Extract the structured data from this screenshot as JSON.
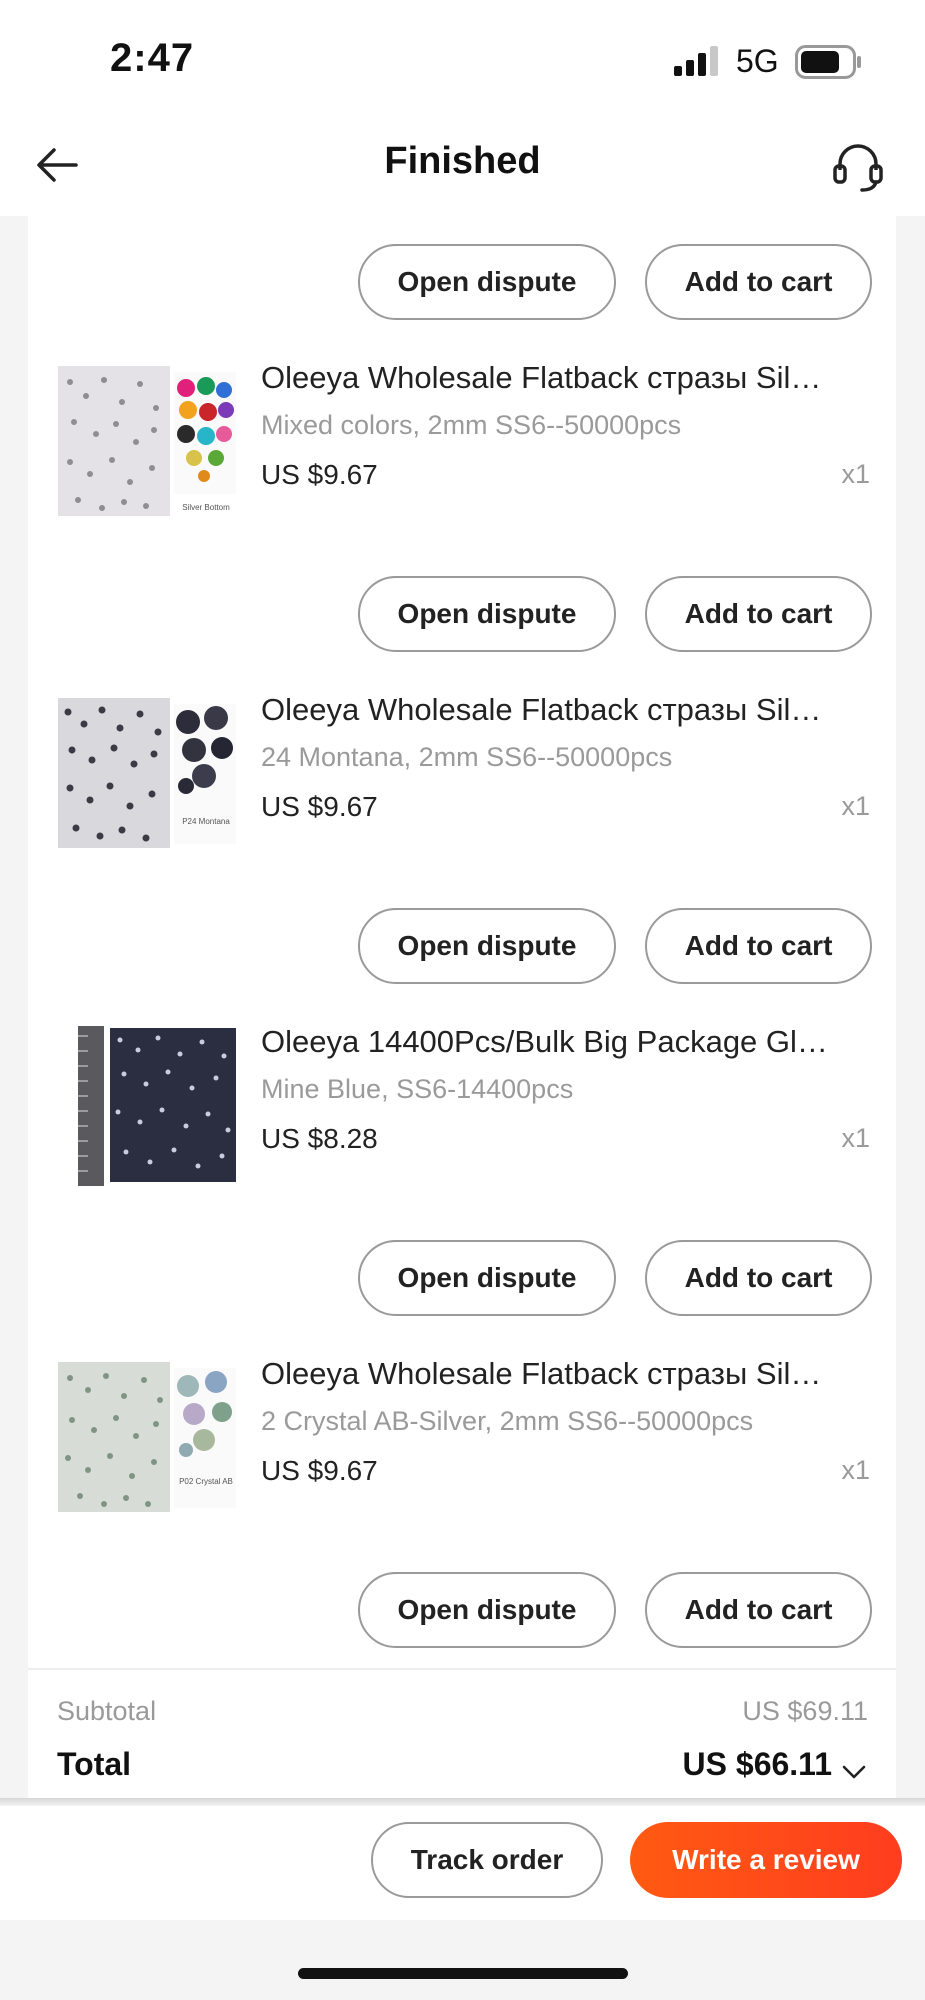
{
  "status_bar": {
    "time": "2:47",
    "network": "5G"
  },
  "header": {
    "title": "Finished"
  },
  "buttons": {
    "open_dispute": "Open dispute",
    "add_to_cart": "Add to cart",
    "track_order": "Track order",
    "write_review": "Write a review"
  },
  "items": [
    {
      "title": "Oleeya Wholesale Flatback стразы Sil…",
      "variant": "Mixed colors, 2mm SS6--50000pcs",
      "price": "US $9.67",
      "qty": "x1",
      "thumb_caption": "Silver  Bottom"
    },
    {
      "title": "Oleeya Wholesale Flatback стразы Sil…",
      "variant": "24 Montana, 2mm SS6--50000pcs",
      "price": "US $9.67",
      "qty": "x1",
      "thumb_caption": "P24 Montana"
    },
    {
      "title": "Oleeya 14400Pcs/Bulk Big Package Gl…",
      "variant": "Mine Blue, SS6-14400pcs",
      "price": "US $8.28",
      "qty": "x1",
      "thumb_caption": ""
    },
    {
      "title": "Oleeya Wholesale Flatback стразы Sil…",
      "variant": "2 Crystal AB-Silver, 2mm SS6--50000pcs",
      "price": "US $9.67",
      "qty": "x1",
      "thumb_caption": "P02 Crystal AB"
    }
  ],
  "summary": {
    "subtotal_label": "Subtotal",
    "subtotal_value": "US $69.11",
    "total_label": "Total",
    "total_value": "US $66.11"
  },
  "colors": {
    "accent": "#ff4d14",
    "muted": "#9a9a9a"
  }
}
